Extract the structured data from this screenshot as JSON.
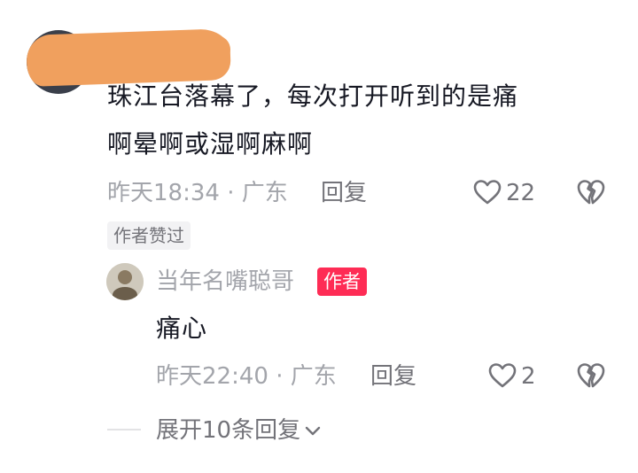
{
  "comment": {
    "text_line1": "珠江台落幕了，每次打开听到的是痛",
    "text_line2": "啊晕啊或湿啊麻啊",
    "time": "昨天18:34",
    "dot": "·",
    "location": "广东",
    "reply_label": "回复",
    "like_count": "22",
    "liked_by_author_badge": "作者赞过"
  },
  "reply": {
    "username": "当年名嘴聪哥",
    "author_tag": "作者",
    "text": "痛心",
    "time": "昨天22:40",
    "dot": "·",
    "location": "广东",
    "reply_label": "回复",
    "like_count": "2"
  },
  "expand_replies_label": "展开10条回复",
  "icons": {
    "like": "heart-outline-icon",
    "dislike": "broken-heart-icon",
    "expand": "chevron-down-icon"
  },
  "colors": {
    "author_tag": "#fe2c55",
    "redaction": "#f0a05e",
    "meta_text": "#a3a5ab"
  }
}
